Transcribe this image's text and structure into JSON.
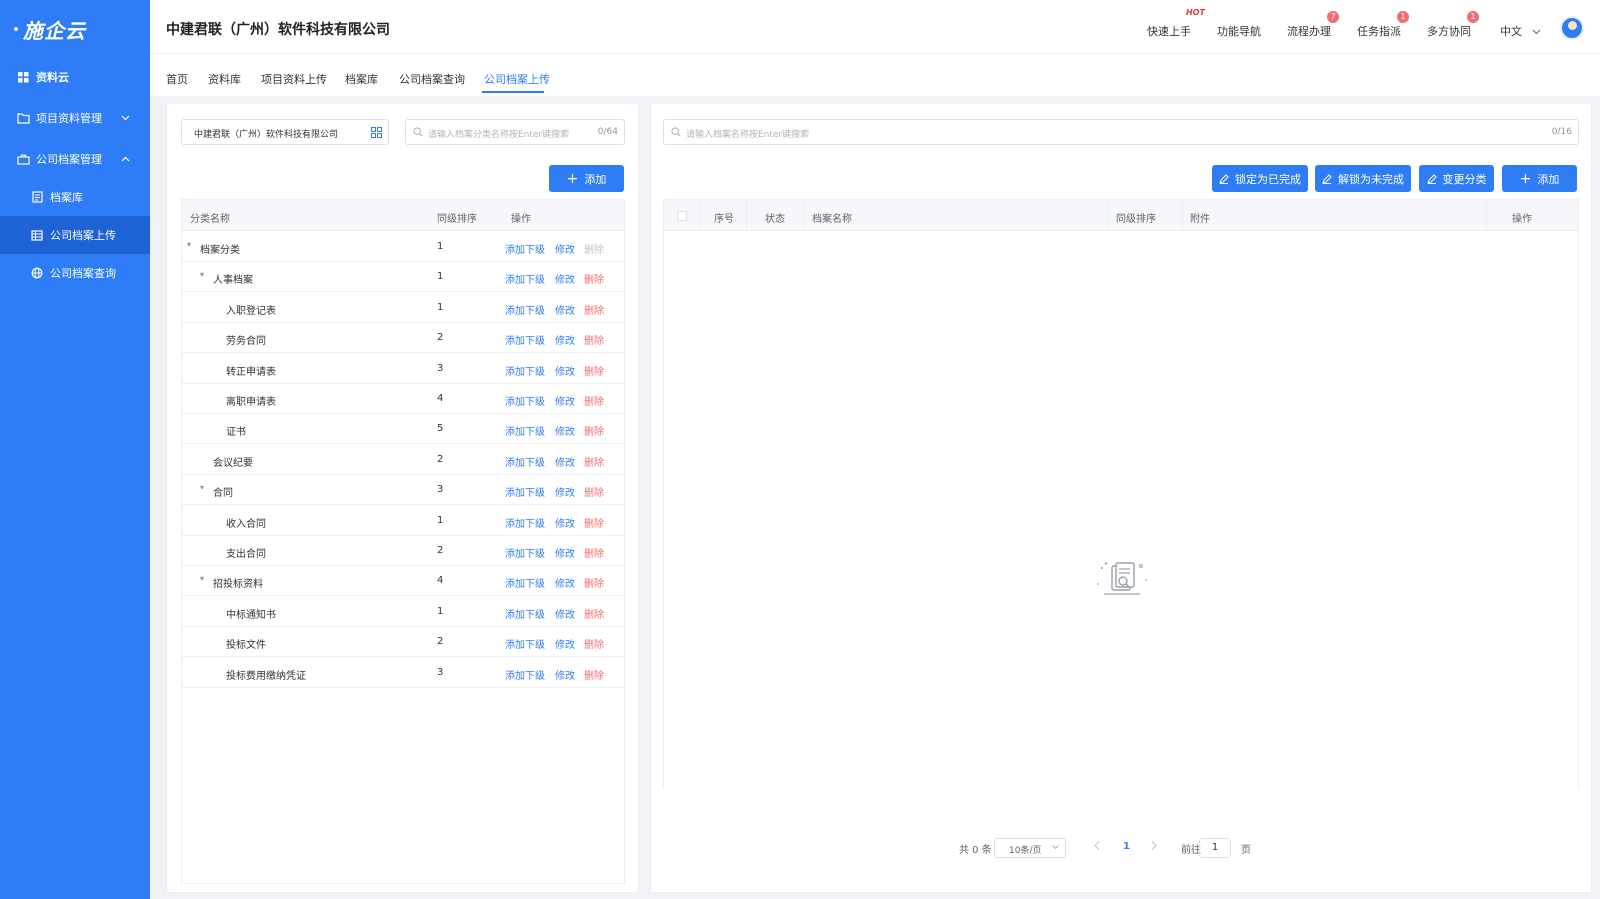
{
  "sidebar": {
    "logo": "施企云",
    "items": [
      {
        "label": "资料云"
      },
      {
        "label": "项目资料管理"
      },
      {
        "label": "公司档案管理"
      },
      {
        "label": "档案库"
      },
      {
        "label": "公司档案上传"
      },
      {
        "label": "公司档案查询"
      }
    ]
  },
  "header": {
    "company": "中建君联（广州）软件科技有限公司",
    "quick_start": "快速上手",
    "hot_badge": "HOT",
    "func_nav": "功能导航",
    "process": "流程办理",
    "process_badge": "7",
    "task": "任务指派",
    "task_badge": "1",
    "collab": "多方协同",
    "collab_badge": "1",
    "lang": "中文"
  },
  "tabs": [
    {
      "label": "首页"
    },
    {
      "label": "资料库"
    },
    {
      "label": "项目资料上传"
    },
    {
      "label": "档案库"
    },
    {
      "label": "公司档案查询"
    },
    {
      "label": "公司档案上传"
    }
  ],
  "left": {
    "company_select": "中建君联（广州）软件科技有限公司",
    "search_placeholder": "请输入档案分类名称按Enter键搜索",
    "search_count": "0/64",
    "add_button": "添加",
    "columns": {
      "name": "分类名称",
      "sort": "同级排序",
      "action": "操作"
    },
    "actions": {
      "add_child": "添加下级",
      "edit": "修改",
      "delete": "删除"
    },
    "rows": [
      {
        "name": "档案分类",
        "sort": "1"
      },
      {
        "name": "人事档案",
        "sort": "1"
      },
      {
        "name": "入职登记表",
        "sort": "1"
      },
      {
        "name": "劳务合同",
        "sort": "2"
      },
      {
        "name": "转正申请表",
        "sort": "3"
      },
      {
        "name": "离职申请表",
        "sort": "4"
      },
      {
        "name": "证书",
        "sort": "5"
      },
      {
        "name": "会议纪要",
        "sort": "2"
      },
      {
        "name": "合同",
        "sort": "3"
      },
      {
        "name": "收入合同",
        "sort": "1"
      },
      {
        "name": "支出合同",
        "sort": "2"
      },
      {
        "name": "招投标资料",
        "sort": "4"
      },
      {
        "name": "中标通知书",
        "sort": "1"
      },
      {
        "name": "投标文件",
        "sort": "2"
      },
      {
        "name": "投标费用缴纳凭证",
        "sort": "3"
      }
    ]
  },
  "right": {
    "search_placeholder": "请输入档案名称按Enter键搜索",
    "search_count": "0/16",
    "lock_button": "锁定为已完成",
    "unlock_button": "解锁为未完成",
    "change_button": "变更分类",
    "add_button": "添加",
    "columns": {
      "index": "序号",
      "status": "状态",
      "name": "档案名称",
      "sort": "同级排序",
      "attach": "附件",
      "action": "操作"
    },
    "pagination": {
      "total": "共 0 条",
      "page_size": "10条/页",
      "current": "1",
      "goto_label": "前往",
      "goto_value": "1",
      "page_unit": "页"
    }
  }
}
